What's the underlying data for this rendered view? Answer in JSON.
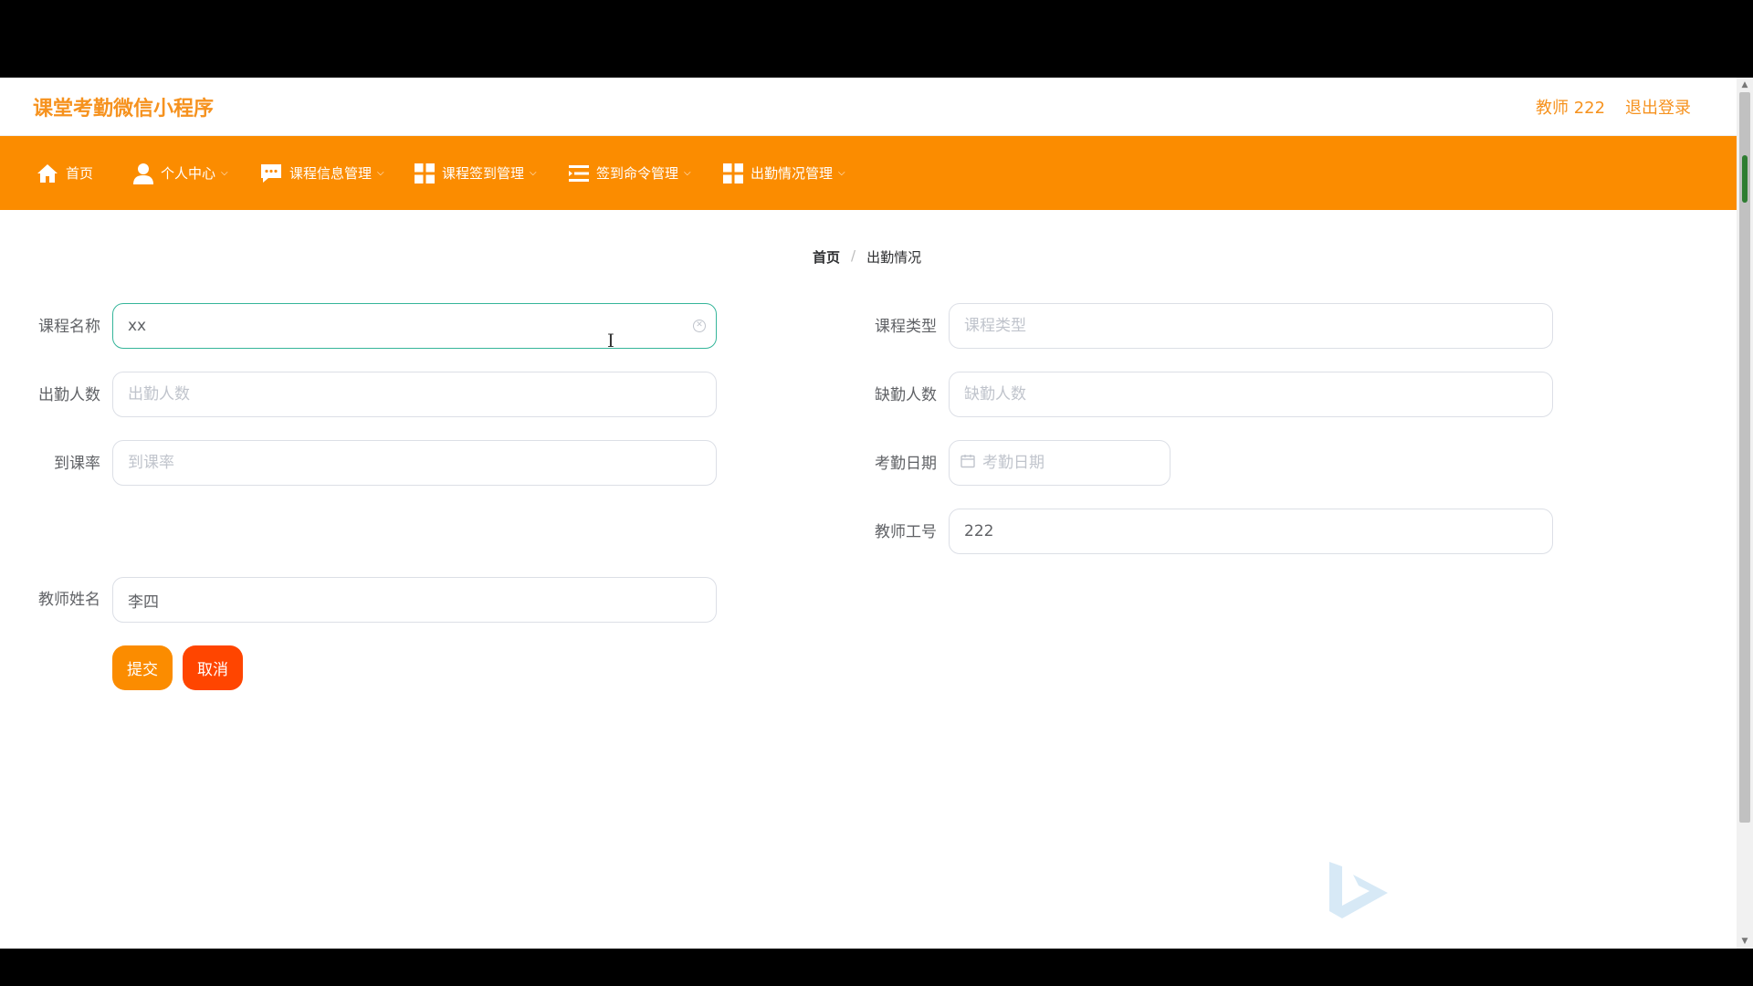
{
  "header": {
    "app_title": "课堂考勤微信小程序",
    "user": "教师 222",
    "logout": "退出登录"
  },
  "nav": {
    "items": [
      {
        "label": "首页",
        "icon": "home-icon",
        "has_dropdown": false
      },
      {
        "label": "个人中心",
        "icon": "user-icon",
        "has_dropdown": true
      },
      {
        "label": "课程信息管理",
        "icon": "chat-icon",
        "has_dropdown": true
      },
      {
        "label": "课程签到管理",
        "icon": "grid-icon",
        "has_dropdown": true
      },
      {
        "label": "签到命令管理",
        "icon": "list-icon",
        "has_dropdown": true
      },
      {
        "label": "出勤情况管理",
        "icon": "grid-icon",
        "has_dropdown": true
      }
    ],
    "dropdown_glyph": "⌵"
  },
  "breadcrumb": {
    "home": "首页",
    "separator": "/",
    "current": "出勤情况"
  },
  "form": {
    "course_name": {
      "label": "课程名称",
      "value": "xx",
      "placeholder": ""
    },
    "course_type": {
      "label": "课程类型",
      "value": "",
      "placeholder": "课程类型"
    },
    "attendance_count": {
      "label": "出勤人数",
      "value": "",
      "placeholder": "出勤人数"
    },
    "absence_count": {
      "label": "缺勤人数",
      "value": "",
      "placeholder": "缺勤人数"
    },
    "attendance_rate": {
      "label": "到课率",
      "value": "",
      "placeholder": "到课率"
    },
    "attendance_date": {
      "label": "考勤日期",
      "value": "",
      "placeholder": "考勤日期"
    },
    "teacher_id": {
      "label": "教师工号",
      "value": "222",
      "placeholder": ""
    },
    "teacher_name": {
      "label": "教师姓名",
      "value": "李四",
      "placeholder": ""
    },
    "submit_label": "提交",
    "cancel_label": "取消"
  },
  "colors": {
    "accent": "#fb8c00",
    "title": "#f6921e",
    "cancel": "#ff4500",
    "focus_border": "#35b59a"
  }
}
